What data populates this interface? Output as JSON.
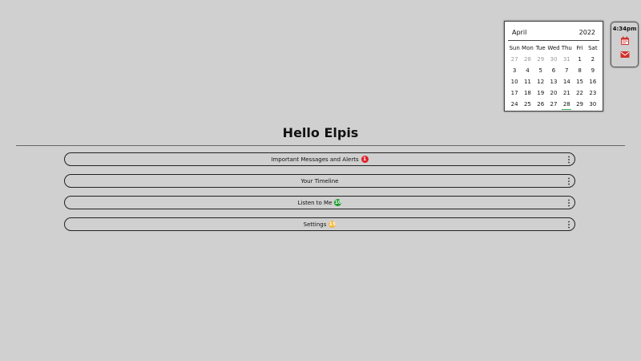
{
  "calendar": {
    "month": "April",
    "year": "2022",
    "weekdays": [
      "Sun",
      "Mon",
      "Tue",
      "Wed",
      "Thu",
      "Fri",
      "Sat"
    ],
    "weeks": [
      [
        {
          "d": "27",
          "muted": true
        },
        {
          "d": "28",
          "muted": true
        },
        {
          "d": "29",
          "muted": true
        },
        {
          "d": "30",
          "muted": true
        },
        {
          "d": "31",
          "muted": true
        },
        {
          "d": "1"
        },
        {
          "d": "2"
        }
      ],
      [
        {
          "d": "3"
        },
        {
          "d": "4"
        },
        {
          "d": "5"
        },
        {
          "d": "6"
        },
        {
          "d": "7"
        },
        {
          "d": "8"
        },
        {
          "d": "9"
        }
      ],
      [
        {
          "d": "10"
        },
        {
          "d": "11"
        },
        {
          "d": "12"
        },
        {
          "d": "13"
        },
        {
          "d": "14"
        },
        {
          "d": "15"
        },
        {
          "d": "16"
        }
      ],
      [
        {
          "d": "17"
        },
        {
          "d": "18"
        },
        {
          "d": "19"
        },
        {
          "d": "20"
        },
        {
          "d": "21"
        },
        {
          "d": "22"
        },
        {
          "d": "23"
        }
      ],
      [
        {
          "d": "24"
        },
        {
          "d": "25"
        },
        {
          "d": "26"
        },
        {
          "d": "27"
        },
        {
          "d": "28",
          "today": true
        },
        {
          "d": "29"
        },
        {
          "d": "30"
        }
      ]
    ],
    "today_marker_color": "#3aa35a"
  },
  "side_widget": {
    "time": "4:34pm",
    "icons": [
      "calendar-icon",
      "envelope-icon"
    ],
    "icon_color": "#d0312d"
  },
  "page": {
    "title": "Hello Elpis"
  },
  "menu": {
    "items": [
      {
        "label": "Important Messages and Alerts",
        "badge": "1",
        "badge_color": "#e0202a"
      },
      {
        "label": "Your Timeline",
        "badge": null
      },
      {
        "label": "Listen to Me",
        "badge": "10",
        "badge_color": "#1f9a2e"
      },
      {
        "label": "Settings",
        "badge": "15",
        "badge_color": "#f2b63a"
      }
    ]
  }
}
